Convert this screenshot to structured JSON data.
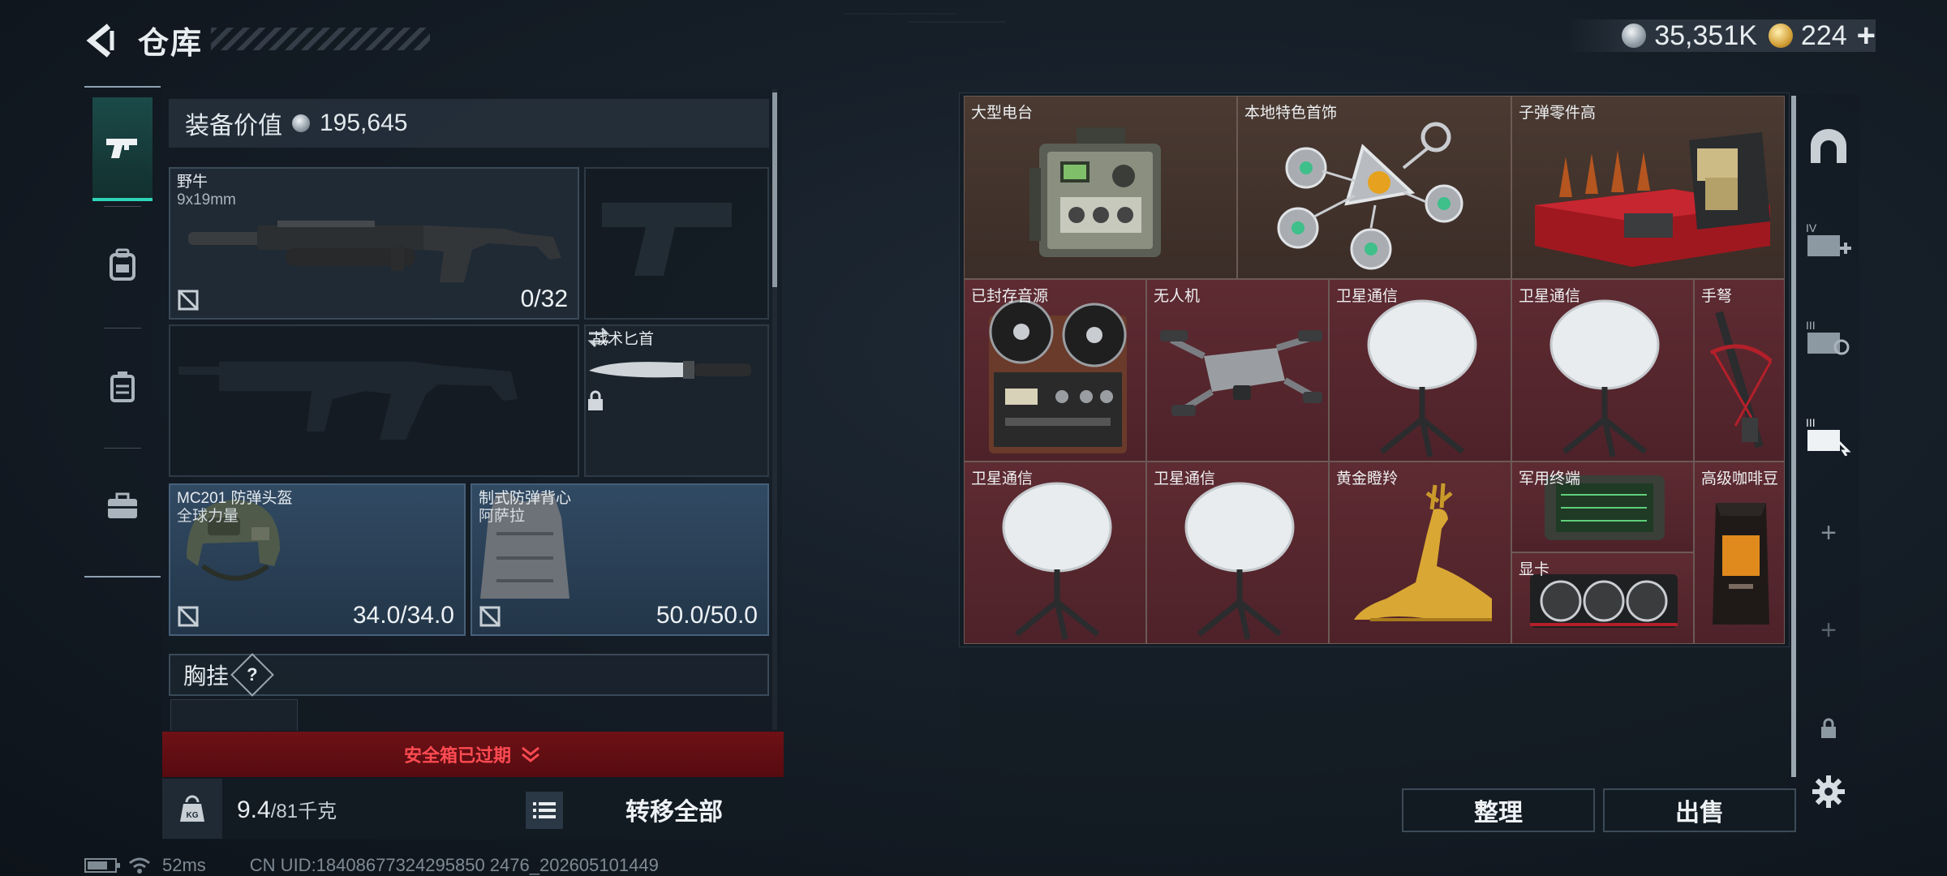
{
  "header": {
    "title": "仓库",
    "currency_silver": "35,351K",
    "currency_gold": "224",
    "gold_plus": "+"
  },
  "side_tabs": [
    {
      "name": "weapons",
      "icon": "pistol-icon",
      "active": true
    },
    {
      "name": "equipment",
      "icon": "backpack-icon",
      "active": false
    },
    {
      "name": "container",
      "icon": "case-icon",
      "active": false
    },
    {
      "name": "toolbox",
      "icon": "toolbox-icon",
      "active": false
    }
  ],
  "loadout": {
    "value_label": "装备价值",
    "value": "195,645",
    "primary": {
      "name": "野牛",
      "caliber": "9x19mm",
      "ammo": "0/32"
    },
    "knife": {
      "name": "战术匕首"
    },
    "helmet": {
      "name": "MC201 防弹头盔",
      "maker": "全球力量",
      "durability": "34.0/34.0"
    },
    "armor": {
      "name": "制式防弹背心",
      "maker": "阿萨拉",
      "durability": "50.0/50.0"
    },
    "chest_rig_label": "胸挂",
    "chest_rig_help": "?",
    "safe_box_status": "安全箱已过期",
    "weight_current": "9.4",
    "weight_max": "/81千克",
    "kg_badge": "KG",
    "transfer_all": "转移全部"
  },
  "storage": {
    "items": [
      {
        "label": "大型电台",
        "tone": "brown",
        "icon": "radio-icon"
      },
      {
        "label": "本地特色首饰",
        "tone": "brown",
        "icon": "jewelry-icon"
      },
      {
        "label": "子弹零件高",
        "tone": "brown",
        "icon": "ammo-parts-icon"
      },
      {
        "label": "已封存音源",
        "tone": "red",
        "icon": "tape-recorder-icon"
      },
      {
        "label": "无人机",
        "tone": "red",
        "icon": "drone-icon"
      },
      {
        "label": "卫星通信",
        "tone": "red",
        "icon": "satellite-dish-icon"
      },
      {
        "label": "卫星通信",
        "tone": "red",
        "icon": "satellite-dish-icon"
      },
      {
        "label": "手弩",
        "tone": "red",
        "icon": "crossbow-icon"
      },
      {
        "label": "卫星通信",
        "tone": "red",
        "icon": "satellite-dish-icon"
      },
      {
        "label": "卫星通信",
        "tone": "red",
        "icon": "satellite-dish-icon"
      },
      {
        "label": "黄金瞪羚",
        "tone": "red",
        "icon": "golden-gazelle-icon"
      },
      {
        "label": "军用终端",
        "tone": "red",
        "icon": "military-terminal-icon"
      },
      {
        "label": "显卡",
        "tone": "red",
        "icon": "graphics-card-icon"
      },
      {
        "label": "高级咖啡豆",
        "tone": "red",
        "icon": "coffee-bag-icon"
      }
    ],
    "sort_button": "整理",
    "sell_button": "出售"
  },
  "right_tabs": {
    "tab_iv": "IV",
    "tab_iii_a": "III",
    "tab_iii_b": "III",
    "add_symbol": "+"
  },
  "status": {
    "ping": "52ms",
    "uid": "CN UID:18408677324295850 2476_202605101449"
  },
  "colors": {
    "accent": "#2fd3b7",
    "alert": "#ff4b52",
    "item_brown": "#4a3a32",
    "item_red": "#5e2b32"
  }
}
